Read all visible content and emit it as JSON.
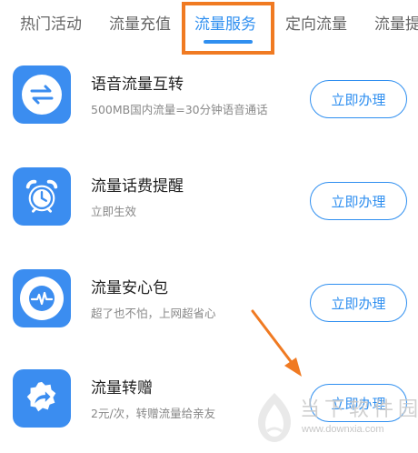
{
  "tabs": [
    {
      "label": "热门活动",
      "active": false
    },
    {
      "label": "流量充值",
      "active": false
    },
    {
      "label": "流量服务",
      "active": true
    },
    {
      "label": "定向流量",
      "active": false
    },
    {
      "label": "流量提",
      "active": false
    }
  ],
  "items": [
    {
      "title": "语音流量互转",
      "subtitle": "500MB国内流量=30分钟语音通话",
      "button": "立即办理",
      "icon": "swap-arrows-icon"
    },
    {
      "title": "流量话费提醒",
      "subtitle": "立即生效",
      "button": "立即办理",
      "icon": "alarm-clock-icon"
    },
    {
      "title": "流量安心包",
      "subtitle": "超了也不怕，上网超省心",
      "button": "立即办理",
      "icon": "pulse-icon"
    },
    {
      "title": "流量转赠",
      "subtitle": "2元/次，转赠流量给亲友",
      "button": "立即办理",
      "icon": "share-forward-icon"
    }
  ],
  "watermark": {
    "name": "当下软件园",
    "url": "www.downxia.com"
  },
  "colors": {
    "accent": "#2f8ff0",
    "highlight": "#f07a22",
    "icon_bg": "#3b8df0"
  }
}
